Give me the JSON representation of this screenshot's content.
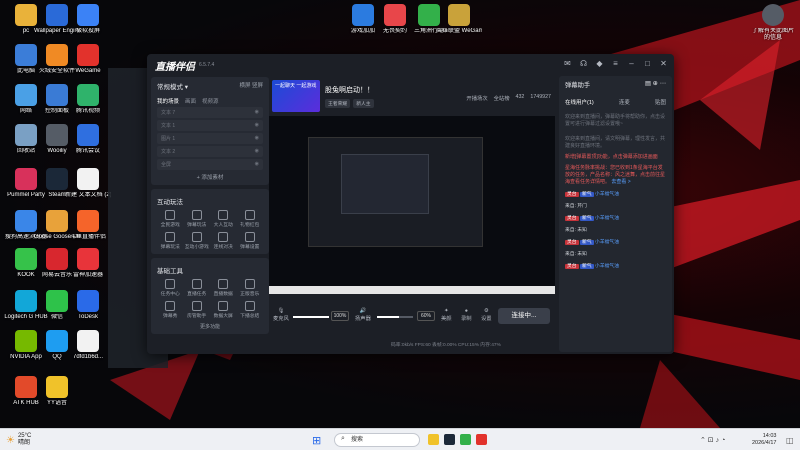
{
  "desktop": {
    "icons": [
      {
        "label": "pc",
        "color": "#e9b23a"
      },
      {
        "label": "Wallpaper Engine:...",
        "color": "#2a6ad8"
      },
      {
        "label": "极软投屏",
        "color": "#3b82f6"
      },
      {
        "label": "此电脑",
        "color": "#3b7dd8"
      },
      {
        "label": "火绒安全软件",
        "color": "#f08a24"
      },
      {
        "label": "WeGame",
        "color": "#e2322c"
      },
      {
        "label": "网络",
        "color": "#4aa0e6"
      },
      {
        "label": "控制面板",
        "color": "#3a7bd5"
      },
      {
        "label": "腾讯视频",
        "color": "#2fb36b"
      },
      {
        "label": "回收站",
        "color": "#7aa0c4"
      },
      {
        "label": "Wooiliy",
        "color": "#555c66"
      },
      {
        "label": "腾讯会议",
        "color": "#2f6fe0"
      },
      {
        "label": "Pummel Party",
        "color": "#d8315b"
      },
      {
        "label": "Steam",
        "color": "#1b2838"
      },
      {
        "label": "新建 文本文档 (2)",
        "color": "#f2f2f2"
      },
      {
        "label": "搜狗高速浏览器",
        "color": "#3a86e8"
      },
      {
        "label": "Goose Goose Duck",
        "color": "#e8a23a"
      },
      {
        "label": "斗鱼直播伴侣",
        "color": "#f5642a"
      },
      {
        "label": "KOOK",
        "color": "#36c24a"
      },
      {
        "label": "网易云音乐",
        "color": "#d8272e"
      },
      {
        "label": "雷神加速器",
        "color": "#e8343a"
      },
      {
        "label": "Logitech G HUB",
        "color": "#12a7d8"
      },
      {
        "label": "微信",
        "color": "#2ec24a"
      },
      {
        "label": "ToDesk",
        "color": "#2a6ae8"
      },
      {
        "label": "NVIDIA App",
        "color": "#76b900"
      },
      {
        "label": "QQ",
        "color": "#1e9df1"
      },
      {
        "label": "7dfd1b6d...",
        "color": "#f2f2f2"
      },
      {
        "label": "ATK HUB",
        "color": "#e24a2a"
      },
      {
        "label": "YY语音",
        "color": "#f0c22a"
      }
    ],
    "top_icons": [
      {
        "label": "游戏加加",
        "color": "#2b7be0"
      },
      {
        "label": "无畏契约",
        "color": "#e8464a"
      },
      {
        "label": "三角洲行动",
        "color": "#33b04a"
      },
      {
        "label": "英雄联盟 WeGame版",
        "color": "#c9a23a"
      }
    ],
    "right_icon": {
      "label": "了解有关此图片的信息",
      "color": "#555c66"
    }
  },
  "app": {
    "logo": "直播伴侣",
    "version": "6.5.7.4",
    "mode": {
      "label": "常规模式 ▾",
      "action1": "横屏",
      "action2": "竖屏"
    },
    "scene_tabs": [
      "我的场景",
      "画面",
      "视频源"
    ],
    "scenes": [
      "文本 7",
      "文本 1",
      "图片 1",
      "文本 2",
      "全屏"
    ],
    "add_material": "+ 添加素材",
    "interactive_title": "互动玩法",
    "interactive_tools": [
      "全民游戏",
      "弹幕玩法",
      "大人互动",
      "礼物红包",
      "弹幕玩法",
      "互动小游戏",
      "连线对决",
      "弹幕设置"
    ],
    "basic_title": "基础工具",
    "basic_tools": [
      "任务中心",
      "直播任务",
      "直播数据",
      "正版音乐",
      "弹幕秀",
      "房管助手",
      "数据大屏",
      "下播总结"
    ],
    "more": "更多功能",
    "stream": {
      "thumb_text": "一起聊天 一起游戏",
      "title": "股兔啊启动！！",
      "tags": [
        "王者荣耀",
        "新人主"
      ],
      "right": [
        "开播场次",
        "全站榜",
        "432",
        "1749927"
      ]
    },
    "mixer": {
      "mic_label": "麦克风",
      "mic_pct": "100%",
      "mic_level": 1.0,
      "speaker_label": "扬声器",
      "speaker_pct": "60%",
      "speaker_level": 0.6,
      "tools": [
        "美颜",
        "录制",
        "设置"
      ],
      "go_live": "连接中..."
    },
    "stats": "码率:0kb/s  FPS:60  丢帧:0.00%  CPU:15%  内存:47%",
    "danmaku": {
      "title": "弹幕助手",
      "tabs": [
        "在线用户(1)",
        "连麦",
        "贴图"
      ],
      "msg1": "欢迎来到直播间，弹幕助手将帮助你，点击设置可进行弹幕过滤设置哦~",
      "msg2": "欢迎来到直播间，请文明弹幕，理性发言，共建良好直播环境。",
      "notice": "新增[弹幕置顶]功能，点击弹幕添加进画面",
      "task": "星海任务脉率挑战：您已收到1条星海平台发放的任务，产品名称：风之迷舞，点击前往星海查看任务详情吧。",
      "task_link": "去查看 >",
      "entries": [
        {
          "tag": "灵台",
          "sub": "新气",
          "text": "小羊福气油"
        },
        {
          "tag": "灵台",
          "sub": "新气",
          "text": "小羊福气油"
        },
        {
          "tag": "灵台",
          "sub": "新气",
          "text": "小羊福气油"
        },
        {
          "tag": "灵台",
          "sub": "新气",
          "text": "小羊福气油"
        }
      ],
      "from1": "来自: 芹门",
      "from2": "来自: 未知",
      "from3": "来自: 未知"
    }
  },
  "taskbar": {
    "weather_temp": "25°C",
    "weather_desc": "晴朗",
    "search_placeholder": "搜索",
    "time": "14:03",
    "date": "2026/4/17"
  }
}
